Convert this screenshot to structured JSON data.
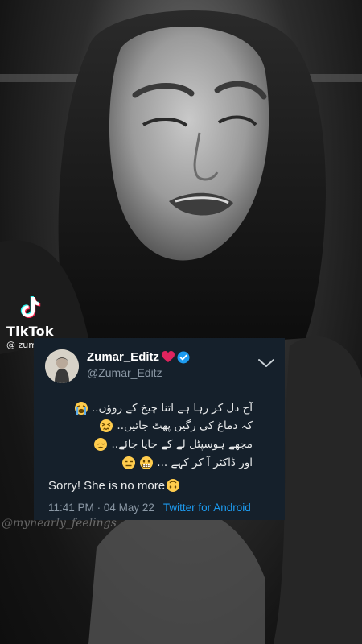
{
  "overlay": {
    "tiktok_label": "TikTok",
    "tiktok_handle": "@ zumar_editz",
    "watermark": "@mynearly_feelings"
  },
  "tweet": {
    "display_name": "Zumar_Editz",
    "handle": "@Zumar_Editz",
    "lines": [
      "آج دل کر رہا ہے اتنا چیخ کے روؤں..",
      "کہ دماغ کی رگیں پھٹ جائیں..",
      "مجھے ہوسپٹل لے کے جایا جائے..",
      "اور ڈاکٹر آ کر کہے ..."
    ],
    "closing": "Sorry! She is no more",
    "time": "11:41 PM",
    "separator": "·",
    "date": "04 May 22",
    "source": "Twitter for Android"
  },
  "colors": {
    "card_bg": "#15202b",
    "secondary_text": "#8b98a5",
    "link_blue": "#1d9bf0",
    "heart_red": "#e0245e",
    "verified_blue": "#1d9bf0"
  },
  "icons": [
    "tiktok-logo-icon",
    "red-heart-icon",
    "verified-badge-icon",
    "chevron-down-icon",
    "loudly-crying-face-icon",
    "persevering-face-icon",
    "disappointed-face-icon",
    "expressionless-face-icon",
    "grimacing-face-icon",
    "upside-down-face-icon"
  ]
}
